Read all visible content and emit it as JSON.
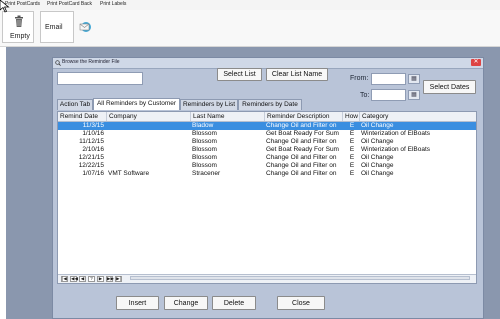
{
  "menu": [
    "Print PostCards",
    "Print PostCard Back",
    "Print Labels"
  ],
  "ribbon": {
    "empty_label": "Empty",
    "email_label": "Email"
  },
  "dialog": {
    "title": "Browse the Reminder File",
    "select_list": "Select List",
    "clear_list_name": "Clear List Name",
    "from_label": "From:",
    "to_label": "To:",
    "select_dates": "Select Dates"
  },
  "tabs": [
    "Action Tab",
    "All Reminders by Customer",
    "Reminders by List",
    "Reminders by Date"
  ],
  "columns": [
    "Remind Date",
    "Company",
    "Last Name",
    "Reminder Description",
    "How",
    "Category"
  ],
  "rows": [
    {
      "date": "11/3/15",
      "company": "",
      "last": "Bladow",
      "desc": "Change Oil and Filter on",
      "how": "E",
      "cat": "Oil Change",
      "selected": true
    },
    {
      "date": "1/10/16",
      "company": "",
      "last": "Blossom",
      "desc": "Get Boat Ready For Sum",
      "how": "E",
      "cat": "Winterization of ElBoats",
      "selected": false
    },
    {
      "date": "11/12/15",
      "company": "",
      "last": "Blossom",
      "desc": "Change Oil and Filter on",
      "how": "E",
      "cat": "Oil Change",
      "selected": false
    },
    {
      "date": "2/10/16",
      "company": "",
      "last": "Blossom",
      "desc": "Get Boat Ready For Sum",
      "how": "E",
      "cat": "Winterization of ElBoats",
      "selected": false
    },
    {
      "date": "12/21/15",
      "company": "",
      "last": "Blossom",
      "desc": "Change Oil and Filter on",
      "how": "E",
      "cat": "Oil Change",
      "selected": false
    },
    {
      "date": "12/22/15",
      "company": "",
      "last": "Blossom",
      "desc": "Change Oil and Filter on",
      "how": "E",
      "cat": "Oil Change",
      "selected": false
    },
    {
      "date": "1/07/16",
      "company": "VMT Software",
      "last": "Stracener",
      "desc": "Change Oil and Filter on",
      "how": "E",
      "cat": "Oil Change",
      "selected": false
    }
  ],
  "nav_buttons": [
    "|◀",
    "◀◀",
    "◀",
    "?",
    "▶",
    "▶▶",
    "▶|"
  ],
  "actions": {
    "insert": "Insert",
    "change": "Change",
    "delete": "Delete",
    "close": "Close"
  },
  "colors": {
    "selection": "#3a8ee0",
    "workspace": "#8a97ae",
    "dialog": "#b9c4d8"
  }
}
